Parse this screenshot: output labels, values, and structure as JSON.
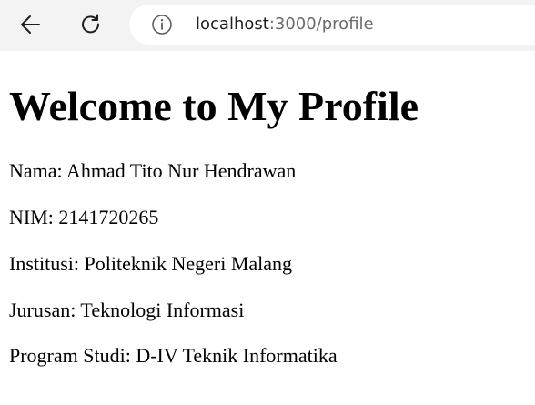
{
  "browser": {
    "back_icon": "arrow-left-icon",
    "reload_icon": "reload-icon",
    "info_icon": "info-icon",
    "url_host": "localhost",
    "url_rest": ":3000/profile"
  },
  "page": {
    "title": "Welcome to My Profile",
    "lines": [
      "Nama: Ahmad Tito Nur Hendrawan",
      "NIM: 2141720265",
      "Institusi: Politeknik Negeri Malang",
      "Jurusan: Teknologi Informasi",
      "Program Studi: D-IV Teknik Informatika"
    ]
  }
}
